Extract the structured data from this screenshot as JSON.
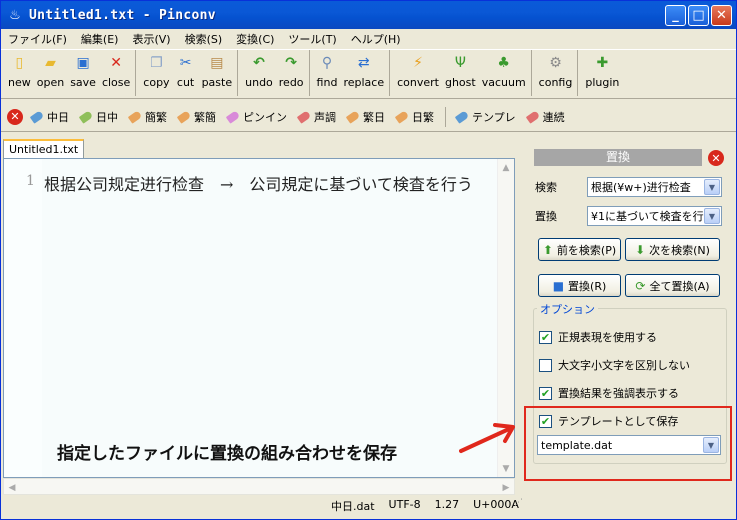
{
  "window": {
    "title": "Untitled1.txt - Pinconv",
    "app_icon": "flame-icon",
    "btn_min": "_",
    "btn_max": "□",
    "btn_close": "✕"
  },
  "menu": [
    "ファイル(F)",
    "編集(E)",
    "表示(V)",
    "検索(S)",
    "変換(C)",
    "ツール(T)",
    "ヘルプ(H)"
  ],
  "toolbar": {
    "groups": [
      [
        {
          "label": "new",
          "icon": "new-file-icon"
        },
        {
          "label": "open",
          "icon": "open-folder-icon"
        },
        {
          "label": "save",
          "icon": "save-disk-icon"
        },
        {
          "label": "close",
          "icon": "close-x-icon"
        }
      ],
      [
        {
          "label": "copy",
          "icon": "copy-icon"
        },
        {
          "label": "cut",
          "icon": "scissors-icon"
        },
        {
          "label": "paste",
          "icon": "paste-icon"
        }
      ],
      [
        {
          "label": "undo",
          "icon": "undo-arrow-icon"
        },
        {
          "label": "redo",
          "icon": "redo-arrow-icon"
        }
      ],
      [
        {
          "label": "find",
          "icon": "magnifier-icon"
        },
        {
          "label": "replace",
          "icon": "replace-icon"
        }
      ],
      [
        {
          "label": "convert",
          "icon": "lightning-icon"
        },
        {
          "label": "ghost",
          "icon": "ghost-icon"
        },
        {
          "label": "vacuum",
          "icon": "vacuum-icon"
        }
      ],
      [
        {
          "label": "config",
          "icon": "gear-icon"
        }
      ],
      [
        {
          "label": "plugin",
          "icon": "puzzle-icon"
        }
      ]
    ]
  },
  "convbar": {
    "items": [
      {
        "label": "中日",
        "color": "#5b9bd5"
      },
      {
        "label": "日中",
        "color": "#8fbf5a"
      },
      {
        "label": "簡繁",
        "color": "#e8a35a"
      },
      {
        "label": "繁簡",
        "color": "#e8a35a"
      },
      {
        "label": "ピンイン",
        "color": "#d98ad9"
      },
      {
        "label": "声調",
        "color": "#e06f6f"
      },
      {
        "label": "繁日",
        "color": "#e8a35a"
      },
      {
        "label": "日繁",
        "color": "#e8a35a"
      },
      {
        "label": "テンプレ",
        "color": "#5b9bd5"
      },
      {
        "label": "連続",
        "color": "#e06f6f"
      }
    ]
  },
  "editor": {
    "tab": "Untitled1.txt",
    "line_number": "1",
    "text": "根据公司规定进行检查　→　公司規定に基づいて検査を行う"
  },
  "status": {
    "dict": "中日.dat",
    "encoding": "UTF-8",
    "position": "1.27",
    "char": "U+000A"
  },
  "annotation": {
    "text": "指定したファイルに置換の組み合わせを保存"
  },
  "panel": {
    "title": "置換",
    "search_label": "検索",
    "search_value": "根据(¥w+)进行检査",
    "replace_label": "置換",
    "replace_value": "¥1に基づいて検査を行",
    "prev_button": "前を検索(P)",
    "next_button": "次を検索(N)",
    "replace_button": "置換(R)",
    "replace_all_button": "全て置換(A)",
    "options_legend": "オプション",
    "opt_regex": "正規表現を使用する",
    "opt_case": "大文字小文字を区別しない",
    "opt_highlight": "置換結果を強調表示する",
    "opt_template": "テンプレートとして保存",
    "template_file": "template.dat",
    "checks": {
      "regex": true,
      "case": false,
      "highlight": true,
      "template": true
    }
  }
}
